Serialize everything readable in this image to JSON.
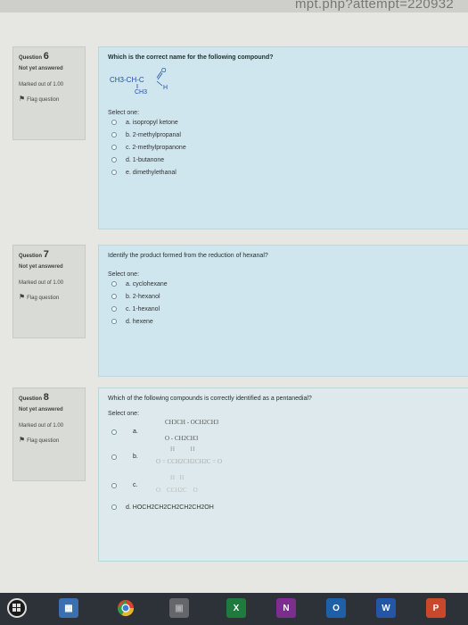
{
  "browser": {
    "url_fragment": "mpt.php?attempt=220932"
  },
  "questions": [
    {
      "label": "Question",
      "number": "6",
      "state": "Not yet answered",
      "marks": "Marked out of 1.00",
      "flag": "Flag question",
      "text": "Which is the correct name for the following compound?",
      "formula": {
        "main": "CH3-CH-C",
        "top": "O",
        "right": "H",
        "below": "CH3"
      },
      "select_label": "Select one:",
      "options": [
        "a. isopropyl ketone",
        "b. 2-methylpropanal",
        "c. 2-methylpropanone",
        "d. 1-butanone",
        "e. dimethylethanal"
      ]
    },
    {
      "label": "Question",
      "number": "7",
      "state": "Not yet answered",
      "marks": "Marked out of 1.00",
      "flag": "Flag question",
      "text": "Identify the product formed from the reduction of hexanal?",
      "select_label": "Select one:",
      "options": [
        "a. cyclohexane",
        "b. 2-hexanol",
        "c. 1-hexanol",
        "d. hexene"
      ]
    },
    {
      "label": "Question",
      "number": "8",
      "state": "Not yet answered",
      "marks": "Marked out of 1.00",
      "flag": "Flag question",
      "text": "Which of the following compounds is correctly identified as a pentanedial?",
      "select_label": "Select one:",
      "options": [
        "a.",
        "b.",
        "c.",
        "d. HOCH2CH2CH2CH2CH2OH"
      ],
      "option_formulas": {
        "a_top": "CH3CH - OCH2CH3",
        "a_bottom": "O - CH2CH3",
        "b_top": "H          H",
        "b_bottom": "O = CCH2CH2CH2C = O",
        "c_top": "H   H",
        "c_bottom": "O    CCH2C    O"
      }
    }
  ],
  "taskbar": {
    "apps": [
      {
        "name": "start",
        "label": "",
        "color": "#1a1a1a"
      },
      {
        "name": "store",
        "label": "",
        "color": "#3a6fb0"
      },
      {
        "name": "chrome",
        "label": "",
        "color": "#e9b52a"
      },
      {
        "name": "photos",
        "label": "",
        "color": "#8a8a8a"
      },
      {
        "name": "excel",
        "label": "X",
        "color": "#1f7a3e"
      },
      {
        "name": "onenote",
        "label": "N",
        "color": "#7b2e8e"
      },
      {
        "name": "outlook",
        "label": "O",
        "color": "#1f5fa8"
      },
      {
        "name": "word",
        "label": "W",
        "color": "#2456a6"
      },
      {
        "name": "powerpoint",
        "label": "P",
        "color": "#c9472a"
      }
    ]
  }
}
